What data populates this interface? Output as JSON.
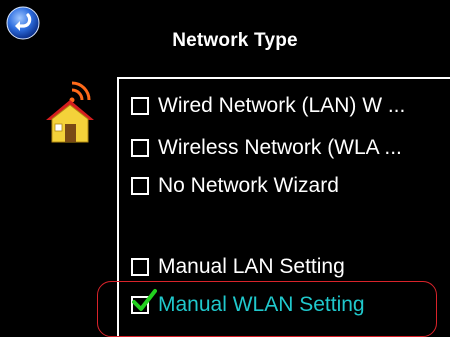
{
  "header": {
    "title": "Network Type",
    "back_icon": "back-arrow-icon"
  },
  "illustration": {
    "icon": "home-network-icon"
  },
  "network_options": [
    {
      "label": "Wired Network (LAN) W ...",
      "checked": false
    },
    {
      "label": "Wireless Network (WLA ...",
      "checked": false
    },
    {
      "label": "No Network Wizard",
      "checked": false
    },
    {
      "label": "Manual LAN Setting",
      "checked": false
    },
    {
      "label": "Manual WLAN Setting",
      "checked": true
    }
  ],
  "colors": {
    "background": "#000000",
    "text": "#ffffff",
    "selected_text": "#20c8cc",
    "check_mark": "#22d11f",
    "highlight_ring": "#d9232a"
  }
}
